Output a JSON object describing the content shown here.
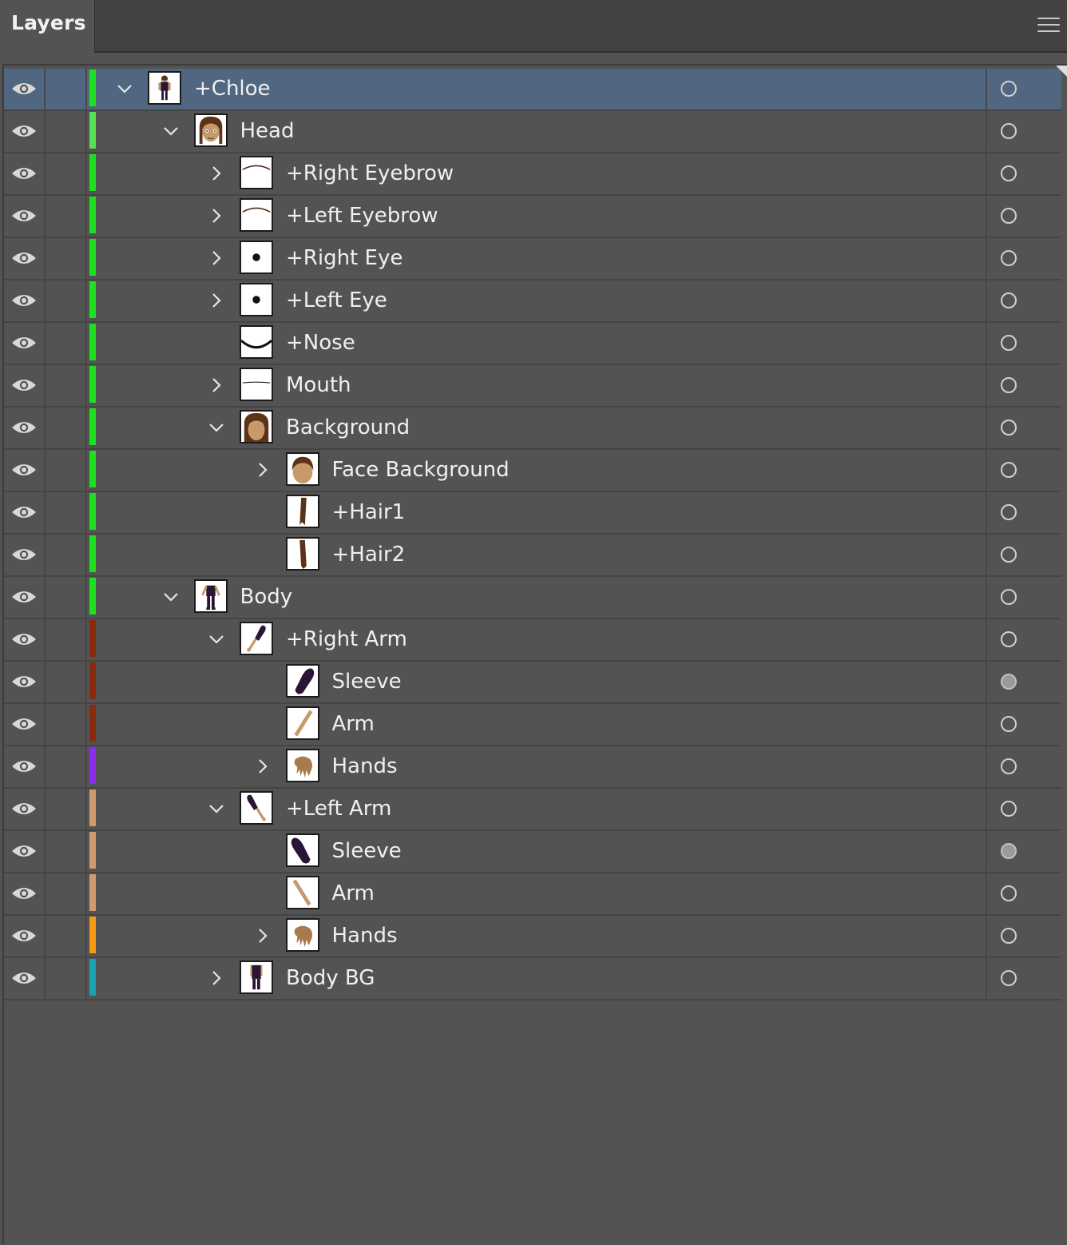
{
  "panel": {
    "tab_label": "Layers",
    "menu_icon": "hamburger-menu-icon"
  },
  "layers": [
    {
      "name": "+Chloe",
      "level": 0,
      "expander": "expanded",
      "color": "#1fe01f",
      "thumb": "figure",
      "targeted": false,
      "selected": true
    },
    {
      "name": "Head",
      "level": 1,
      "expander": "expanded",
      "color": "#55e055",
      "thumb": "face",
      "targeted": false,
      "selected": false
    },
    {
      "name": "+Right Eyebrow",
      "level": 2,
      "expander": "collapsed",
      "color": "#1fe01f",
      "thumb": "eyebrow",
      "targeted": false,
      "selected": false
    },
    {
      "name": "+Left Eyebrow",
      "level": 2,
      "expander": "collapsed",
      "color": "#1fe01f",
      "thumb": "eyebrow",
      "targeted": false,
      "selected": false
    },
    {
      "name": "+Right Eye",
      "level": 2,
      "expander": "collapsed",
      "color": "#1fe01f",
      "thumb": "eye",
      "targeted": false,
      "selected": false
    },
    {
      "name": "+Left Eye",
      "level": 2,
      "expander": "collapsed",
      "color": "#1fe01f",
      "thumb": "eye",
      "targeted": false,
      "selected": false
    },
    {
      "name": "+Nose",
      "level": 2,
      "expander": "none",
      "color": "#1fe01f",
      "thumb": "nose",
      "targeted": false,
      "selected": false
    },
    {
      "name": "Mouth",
      "level": 2,
      "expander": "collapsed",
      "color": "#1fe01f",
      "thumb": "mouth",
      "targeted": false,
      "selected": false
    },
    {
      "name": "Background",
      "level": 2,
      "expander": "expanded",
      "color": "#1fe01f",
      "thumb": "hairhead",
      "targeted": false,
      "selected": false
    },
    {
      "name": "Face Background",
      "level": 3,
      "expander": "collapsed",
      "color": "#1fe01f",
      "thumb": "facebg",
      "targeted": false,
      "selected": false
    },
    {
      "name": "+Hair1",
      "level": 3,
      "expander": "none",
      "color": "#1fe01f",
      "thumb": "hair1",
      "targeted": false,
      "selected": false
    },
    {
      "name": "+Hair2",
      "level": 3,
      "expander": "none",
      "color": "#1fe01f",
      "thumb": "hair2",
      "targeted": false,
      "selected": false
    },
    {
      "name": "Body",
      "level": 1,
      "expander": "expanded",
      "color": "#1fe01f",
      "thumb": "body",
      "targeted": false,
      "selected": false
    },
    {
      "name": "+Right Arm",
      "level": 2,
      "expander": "expanded",
      "color": "#8a2a0c",
      "thumb": "rightarm",
      "targeted": false,
      "selected": false
    },
    {
      "name": "Sleeve",
      "level": 3,
      "expander": "none",
      "color": "#8a2a0c",
      "thumb": "sleeve-r",
      "targeted": true,
      "selected": false
    },
    {
      "name": "Arm",
      "level": 3,
      "expander": "none",
      "color": "#8a2a0c",
      "thumb": "arm-r",
      "targeted": false,
      "selected": false
    },
    {
      "name": "Hands",
      "level": 3,
      "expander": "collapsed",
      "color": "#8b2cf0",
      "thumb": "hand",
      "targeted": false,
      "selected": false
    },
    {
      "name": "+Left Arm",
      "level": 2,
      "expander": "expanded",
      "color": "#cf9a6e",
      "thumb": "leftarm",
      "targeted": false,
      "selected": false
    },
    {
      "name": "Sleeve",
      "level": 3,
      "expander": "none",
      "color": "#cf9a6e",
      "thumb": "sleeve-l",
      "targeted": true,
      "selected": false
    },
    {
      "name": "Arm",
      "level": 3,
      "expander": "none",
      "color": "#cf9a6e",
      "thumb": "arm-l",
      "targeted": false,
      "selected": false
    },
    {
      "name": "Hands",
      "level": 3,
      "expander": "collapsed",
      "color": "#f59a12",
      "thumb": "hand",
      "targeted": false,
      "selected": false
    },
    {
      "name": "Body BG",
      "level": 2,
      "expander": "collapsed",
      "color": "#1aa2b0",
      "thumb": "bodybg",
      "targeted": false,
      "selected": false
    }
  ]
}
